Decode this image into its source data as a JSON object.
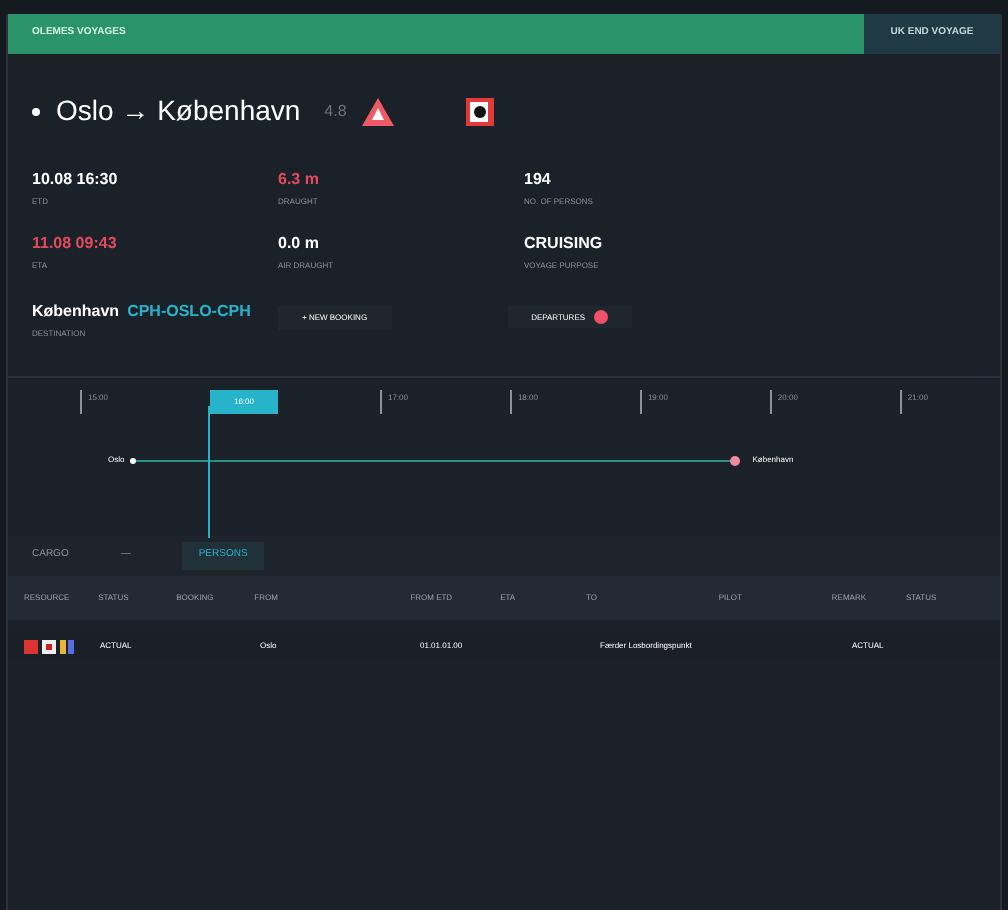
{
  "header": {
    "title": "OLEMES VOYAGES",
    "end_button": "UK END VOYAGE"
  },
  "voyage": {
    "route": "Oslo → København",
    "code": "4.8"
  },
  "fields": [
    {
      "value": "10.08 16:30",
      "label": "ETD",
      "alert": false
    },
    {
      "value": "6.3 m",
      "label": "DRAUGHT",
      "alert": true
    },
    {
      "value": "194",
      "label": "NO. OF PERSONS",
      "alert": false
    },
    {
      "value": "11.08 09:43",
      "label": "ETA",
      "alert": true
    },
    {
      "value": "0.0 m",
      "label": "AIR DRAUGHT",
      "alert": false
    },
    {
      "value": "CRUISING",
      "label": "VOYAGE PURPOSE",
      "alert": false
    }
  ],
  "destination": {
    "name": "København",
    "code": "CPH-OSLO-CPH",
    "label": "DESTINATION"
  },
  "buttons": {
    "new_booking": "+ NEW BOOKING",
    "departures": "DEPARTURES"
  },
  "timeline": {
    "ticks": [
      {
        "label": "15:00",
        "selected": false
      },
      {
        "label": "16:00",
        "selected": true
      },
      {
        "label": "17:00",
        "selected": false
      },
      {
        "label": "18:00",
        "selected": false
      },
      {
        "label": "19:00",
        "selected": false
      },
      {
        "label": "20:00",
        "selected": false
      },
      {
        "label": "21:00",
        "selected": false
      }
    ],
    "from": "Oslo",
    "to": "København"
  },
  "tabs": [
    {
      "label": "CARGO",
      "selected": false
    },
    {
      "label": "—",
      "selected": false
    },
    {
      "label": "PERSONS",
      "selected": true
    }
  ],
  "table": {
    "columns": [
      "RESOURCE",
      "STATUS",
      "BOOKING",
      "FROM",
      "FROM ETD",
      "ETA",
      "TO",
      "PILOT",
      "REMARK",
      "STATUS"
    ],
    "rows": [
      {
        "status": "ACTUAL",
        "from": "Oslo",
        "etd": "01.01.01.00",
        "to": "Færder Losbordingspunkt",
        "remark": "ACTUAL"
      }
    ]
  }
}
